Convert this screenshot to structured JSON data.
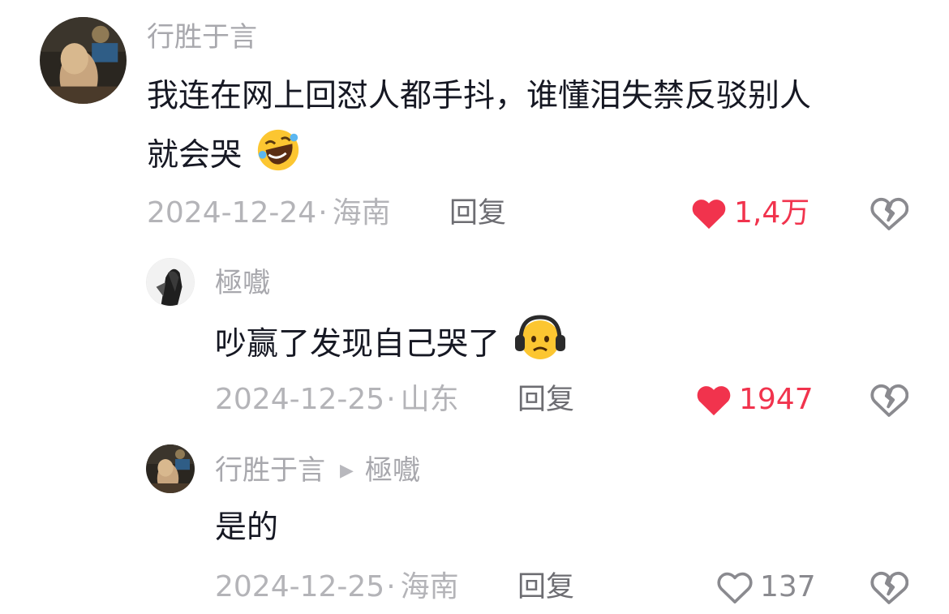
{
  "comments": [
    {
      "user": "行胜于言",
      "text_line1": "我连在网上回怼人都手抖，谁懂泪失禁反驳别人",
      "text_line2": "就会哭",
      "emoji": "rolling-on-floor-laughing-emoji",
      "date": "2024-12-24",
      "location": "海南",
      "reply_label": "回复",
      "likes": "1,4万",
      "liked": true
    },
    {
      "user": "極嚱",
      "text": "吵赢了发现自己哭了",
      "emoji": "headphones-sad-face-emoji",
      "date": "2024-12-25",
      "location": "山东",
      "reply_label": "回复",
      "likes": "1947",
      "liked": true
    },
    {
      "user": "行胜于言",
      "reply_to": "極嚱",
      "text": "是的",
      "date": "2024-12-25",
      "location": "海南",
      "reply_label": "回复",
      "likes": "137",
      "liked": false
    }
  ],
  "separator": "·",
  "colors": {
    "like_active": "#f1334d",
    "meta_gray": "#b4b4b8",
    "text": "#161823"
  }
}
